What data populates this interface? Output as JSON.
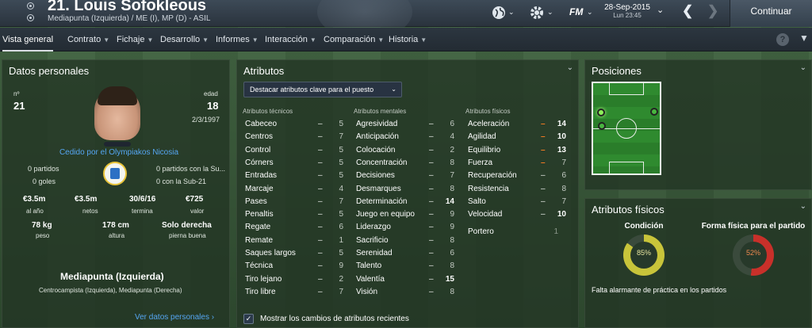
{
  "header": {
    "player_name": "21. Louis Sofokleous",
    "player_sub": "Mediapunta (Izquierda) / ME (I), MP (D) - ASIL",
    "date": "28-Sep-2015",
    "time": "Lun 23:45",
    "logo": "FM",
    "continue_label": "Continuar",
    "icons": [
      "globe-icon",
      "gear-icon",
      "calendar-chevron-icon",
      "back-arrow-icon",
      "forward-arrow-icon"
    ]
  },
  "tabs": [
    {
      "label": "Vista general",
      "active": true,
      "dropdown": false
    },
    {
      "label": "Contrato",
      "active": false,
      "dropdown": true
    },
    {
      "label": "Fichaje",
      "active": false,
      "dropdown": true
    },
    {
      "label": "Desarrollo",
      "active": false,
      "dropdown": true
    },
    {
      "label": "Informes",
      "active": false,
      "dropdown": true
    },
    {
      "label": "Interacción",
      "active": false,
      "dropdown": true
    },
    {
      "label": "Comparación",
      "active": false,
      "dropdown": true
    },
    {
      "label": "Historia",
      "active": false,
      "dropdown": true
    }
  ],
  "help_label": "?",
  "personal": {
    "title": "Datos personales",
    "number_label": "nº",
    "number": "21",
    "age_label": "edad",
    "age": "18",
    "dob": "2/3/1997",
    "loan_text": "Cedido por el Olympiakos Nicosia",
    "matches": "0 partidos",
    "goals": "0 goles",
    "u21_matches": "0 partidos con la Su...",
    "u21_goals": "0 con la Sub-21",
    "wage": "€3.5m",
    "wage_lbl": "al año",
    "net": "€3.5m",
    "net_lbl": "netos",
    "expires": "30/6/16",
    "expires_lbl": "termina",
    "value": "€725",
    "value_lbl": "valor",
    "weight": "78 kg",
    "weight_lbl": "peso",
    "height": "178 cm",
    "height_lbl": "altura",
    "foot": "Solo derecha",
    "foot_lbl": "pierna buena",
    "position_main": "Mediapunta (Izquierda)",
    "position_alt": "Centrocampista (Izquierda), Mediapunta (Derecha)",
    "more_link": "Ver datos personales"
  },
  "attributes": {
    "title": "Atributos",
    "highlight_dropdown": "Destacar atributos clave para el puesto",
    "tech_header": "Atributos técnicos",
    "mental_header": "Atributos mentales",
    "phys_header": "Atributos físicos",
    "technical": [
      {
        "n": "Cabeceo",
        "v": "5"
      },
      {
        "n": "Centros",
        "v": "7"
      },
      {
        "n": "Control",
        "v": "5"
      },
      {
        "n": "Córners",
        "v": "5"
      },
      {
        "n": "Entradas",
        "v": "5"
      },
      {
        "n": "Marcaje",
        "v": "4"
      },
      {
        "n": "Pases",
        "v": "7"
      },
      {
        "n": "Penaltis",
        "v": "5"
      },
      {
        "n": "Regate",
        "v": "6"
      },
      {
        "n": "Remate",
        "v": "1"
      },
      {
        "n": "Saques largos",
        "v": "5"
      },
      {
        "n": "Técnica",
        "v": "9"
      },
      {
        "n": "Tiro lejano",
        "v": "2"
      },
      {
        "n": "Tiro libre",
        "v": "7"
      }
    ],
    "mental": [
      {
        "n": "Agresividad",
        "v": "6"
      },
      {
        "n": "Anticipación",
        "v": "4"
      },
      {
        "n": "Colocación",
        "v": "2"
      },
      {
        "n": "Concentración",
        "v": "8"
      },
      {
        "n": "Decisiones",
        "v": "7"
      },
      {
        "n": "Desmarques",
        "v": "8"
      },
      {
        "n": "Determinación",
        "v": "14"
      },
      {
        "n": "Juego en equipo",
        "v": "9"
      },
      {
        "n": "Liderazgo",
        "v": "9"
      },
      {
        "n": "Sacrificio",
        "v": "8"
      },
      {
        "n": "Serenidad",
        "v": "6"
      },
      {
        "n": "Talento",
        "v": "8"
      },
      {
        "n": "Valentía",
        "v": "15"
      },
      {
        "n": "Visión",
        "v": "8"
      }
    ],
    "physical": [
      {
        "n": "Aceleración",
        "v": "14",
        "orange": true
      },
      {
        "n": "Agilidad",
        "v": "10",
        "orange": true
      },
      {
        "n": "Equilibrio",
        "v": "13",
        "orange": true
      },
      {
        "n": "Fuerza",
        "v": "7",
        "orange": true
      },
      {
        "n": "Recuperación",
        "v": "6",
        "orange": false
      },
      {
        "n": "Resistencia",
        "v": "8",
        "orange": false
      },
      {
        "n": "Salto",
        "v": "7",
        "orange": false
      },
      {
        "n": "Velocidad",
        "v": "10",
        "orange": false
      }
    ],
    "goalkeeper_label": "Portero",
    "goalkeeper_value": "1",
    "recent_changes_label": "Mostrar los cambios de atributos recientes"
  },
  "positions": {
    "title": "Posiciones"
  },
  "physical_panel": {
    "title": "Atributos físicos",
    "condition_label": "Condición",
    "condition_value": "85%",
    "condition_fraction": 0.85,
    "fitness_label": "Forma física para el partido",
    "fitness_value": "52%",
    "fitness_fraction": 0.52,
    "warning": "Falta alarmante de práctica en los partidos"
  },
  "colors": {
    "accent_blue": "#55a6f2",
    "orange": "#f07a22",
    "condition": "#c8c43a",
    "fitness": "#c8302a"
  }
}
